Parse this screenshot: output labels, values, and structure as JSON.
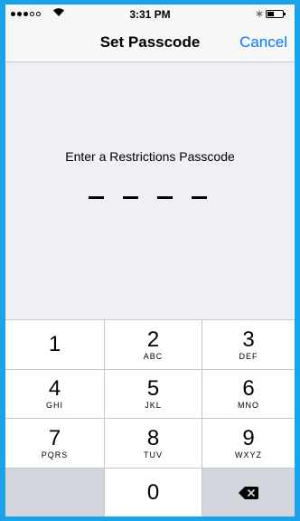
{
  "status_bar": {
    "time": "3:31 PM",
    "signal_bars": 3,
    "signal_total": 5
  },
  "nav": {
    "title": "Set Passcode",
    "cancel_label": "Cancel"
  },
  "prompt": {
    "text": "Enter a Restrictions Passcode",
    "digits_entered": 0,
    "digits_total": 4
  },
  "keypad": {
    "keys": [
      {
        "num": "1",
        "letters": ""
      },
      {
        "num": "2",
        "letters": "ABC"
      },
      {
        "num": "3",
        "letters": "DEF"
      },
      {
        "num": "4",
        "letters": "GHI"
      },
      {
        "num": "5",
        "letters": "JKL"
      },
      {
        "num": "6",
        "letters": "MNO"
      },
      {
        "num": "7",
        "letters": "PQRS"
      },
      {
        "num": "8",
        "letters": "TUV"
      },
      {
        "num": "9",
        "letters": "WXYZ"
      },
      {
        "num": "0",
        "letters": ""
      }
    ],
    "delete_icon": "backspace-icon"
  },
  "colors": {
    "frame": "#1aa3e8",
    "accent": "#007aff",
    "background": "#efeff4",
    "keypad_gray": "#d2d5db"
  }
}
